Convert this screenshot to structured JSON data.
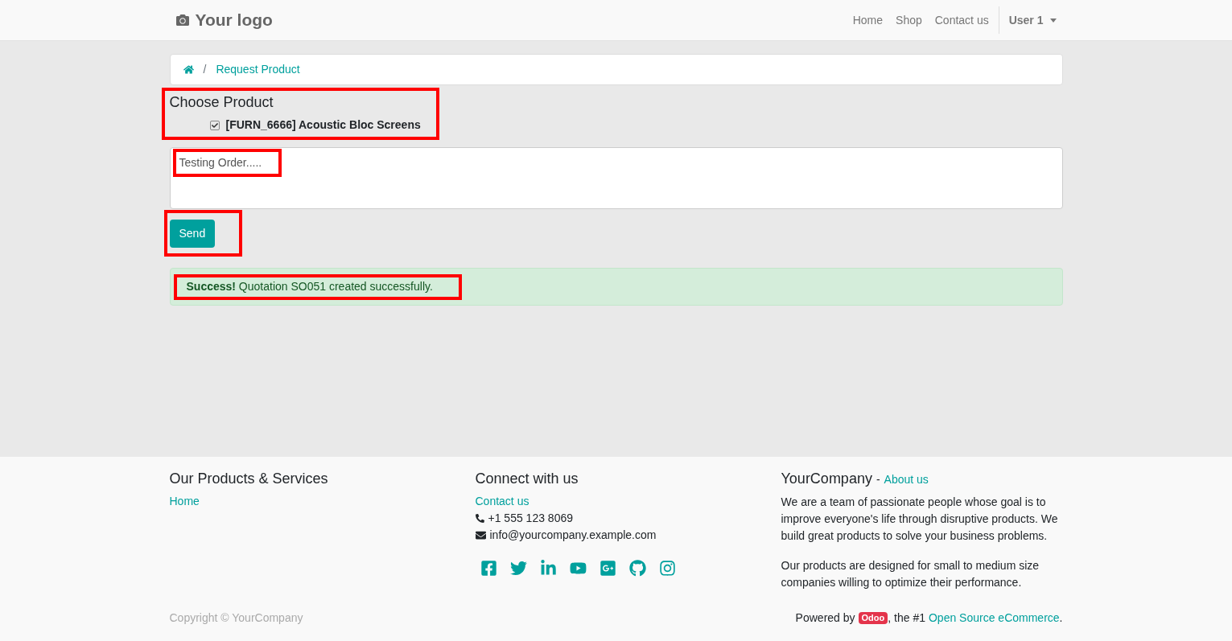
{
  "header": {
    "logo": "Your logo",
    "nav": [
      {
        "label": "Home"
      },
      {
        "label": "Shop"
      },
      {
        "label": "Contact us"
      }
    ],
    "user": "User 1"
  },
  "breadcrumb": {
    "separator": "/",
    "current": "Request Product"
  },
  "form": {
    "title": "Choose Product",
    "product": {
      "label": "[FURN_6666] Acoustic Bloc Screens",
      "checked": true
    },
    "message": "Testing Order.....",
    "send": "Send"
  },
  "alert": {
    "text": "**Success!** Quotation SO051 created successfully."
  },
  "footer": {
    "products": {
      "title": "Our Products & Services",
      "links": [
        "Home"
      ]
    },
    "connect": {
      "title": "Connect with us",
      "contact": "Contact us",
      "phone": "+1 555 123 8069",
      "email": "info@yourcompany.example.com"
    },
    "about": {
      "title": "YourCompany",
      "separator": "-",
      "link": "About us",
      "paragraphs": [
        "We are a team of passionate people whose goal is to improve everyone's life through disruptive products. We build great products to solve your business problems.",
        "Our products are designed for small to medium size companies willing to optimize their performance."
      ]
    },
    "copyright": "Copyright © YourCompany",
    "powered": {
      "prefix": "Powered by",
      "badge": "Odoo",
      "middle": ", the #1",
      "link": "Open Source eCommerce",
      "suffix": "."
    }
  }
}
